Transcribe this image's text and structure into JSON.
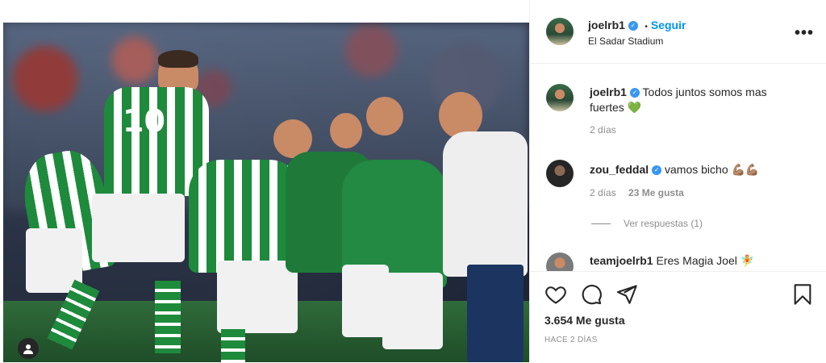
{
  "post": {
    "author": "joelrb1",
    "follow_label": "Seguir",
    "separator": "•",
    "location": "El Sadar Stadium",
    "more_label": "•••"
  },
  "photo": {
    "jersey_number": "10"
  },
  "comments": [
    {
      "user": "joelrb1",
      "verified": true,
      "text": "Todos juntos somos mas fuertes 💚",
      "time": "2 días"
    },
    {
      "user": "zou_feddal",
      "verified": true,
      "text": "vamos bicho 💪🏽💪🏽",
      "time": "2 días",
      "likes": "23 Me gusta"
    },
    {
      "user": "teamjoelrb1",
      "verified": false,
      "text": "Eres Magia Joel 🧚"
    }
  ],
  "replies_label": "Ver respuestas (1)",
  "footer": {
    "likes": "3.654 Me gusta",
    "ago": "HACE 2 DÍAS"
  },
  "icons": {
    "like": "heart-icon",
    "comment": "comment-icon",
    "share": "paper-plane-icon",
    "save": "bookmark-icon",
    "verified": "verified-badge-icon"
  },
  "colors": {
    "accent": "#0095f6",
    "verified": "#3897f0",
    "muted": "#8e8e8e",
    "text": "#262626"
  }
}
